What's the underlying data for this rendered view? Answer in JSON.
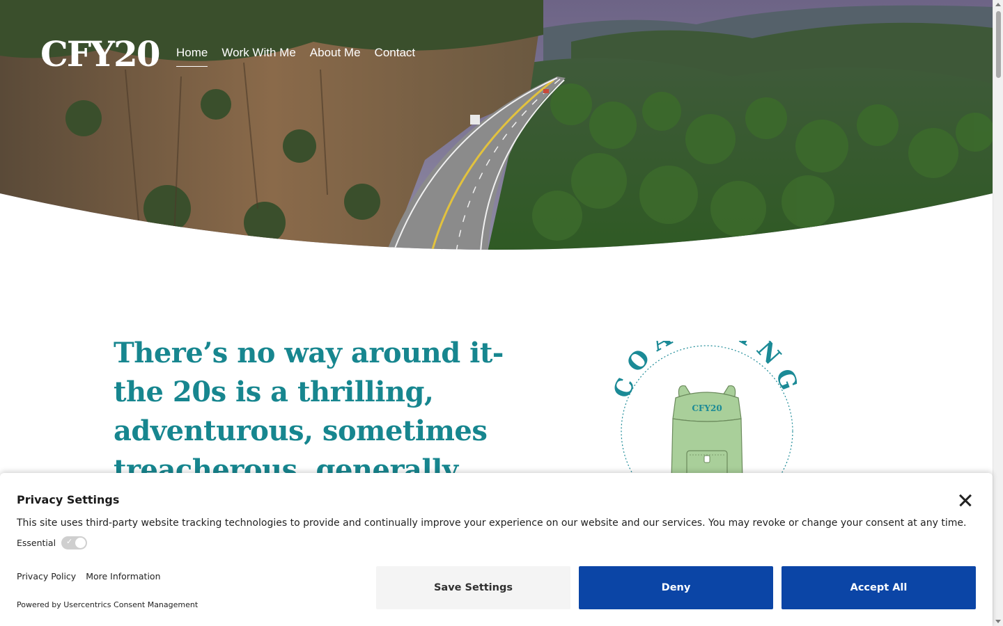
{
  "site": {
    "logo_text": "CFY20",
    "nav": [
      {
        "label": "Home",
        "active": true
      },
      {
        "label": "Work With Me",
        "active": false
      },
      {
        "label": "About Me",
        "active": false
      },
      {
        "label": "Contact",
        "active": false
      }
    ]
  },
  "main": {
    "headline_lines": [
      "There’s no way around it-",
      "the 20s is a thrilling,",
      "adventurous, sometimes",
      "treacherous, generally"
    ],
    "badge": {
      "arc_text": "COACHING",
      "backpack_text": "CFY20"
    }
  },
  "consent": {
    "title": "Privacy Settings",
    "description": "This site uses third-party website tracking technologies to provide and continually improve your experience on our website and our services. You may revoke or change your consent at any time.",
    "essential_label": "Essential",
    "essential_enabled": true,
    "links": [
      "Privacy Policy",
      "More Information"
    ],
    "powered_by": "Powered by Usercentrics Consent Management",
    "buttons": {
      "save": "Save Settings",
      "deny": "Deny",
      "accept": "Accept All"
    }
  },
  "colors": {
    "headline": "#17868f",
    "button_primary": "#0b45a6",
    "badge_green": "#a9cf9a",
    "badge_teal": "#1b8a96"
  }
}
